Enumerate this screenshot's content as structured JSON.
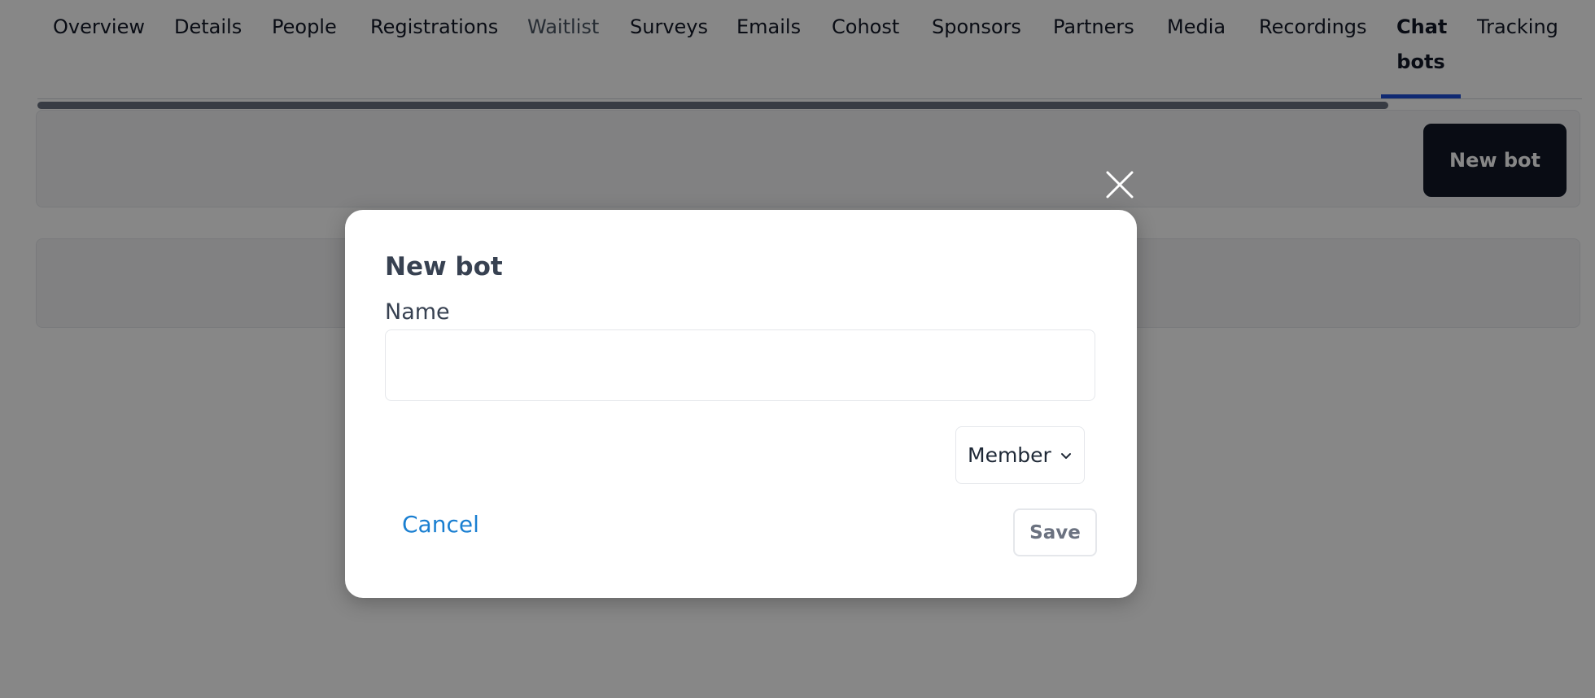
{
  "tabs": [
    {
      "label": "Overview"
    },
    {
      "label": "Details"
    },
    {
      "label": "People"
    },
    {
      "label": "Registrations"
    },
    {
      "label": "Waitlist"
    },
    {
      "label": "Surveys"
    },
    {
      "label": "Emails"
    },
    {
      "label": "Cohost"
    },
    {
      "label": "Sponsors"
    },
    {
      "label": "Partners"
    },
    {
      "label": "Media"
    },
    {
      "label": "Recordings"
    },
    {
      "label": "Chat bots",
      "active": true
    },
    {
      "label": "Tracking"
    }
  ],
  "toolbar": {
    "new_bot_label": "New bot"
  },
  "modal": {
    "title": "New bot",
    "name_label": "Name",
    "name_value": "",
    "name_placeholder": "",
    "role_value": "Member",
    "cancel_label": "Cancel",
    "save_label": "Save"
  },
  "icons": {
    "close": "close-icon",
    "dropdown": "chevron-down-icon"
  },
  "colors": {
    "accent_tab_underline": "#1d4ed8",
    "primary_button": "#111827",
    "link": "#1a7fd1"
  }
}
